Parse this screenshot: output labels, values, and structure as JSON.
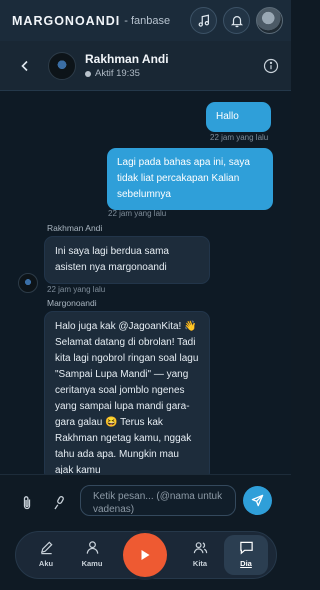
{
  "topbar": {
    "brand": "MARGONOANDI",
    "brand_sub": "- fanbase",
    "icons": [
      "music-icon",
      "bell-icon",
      "user-avatar"
    ]
  },
  "chat_header": {
    "contact_name": "Rakhman Andi",
    "status": "Aktif 19:35",
    "icons": [
      "back-arrow-icon",
      "info-icon"
    ]
  },
  "messages": [
    {
      "direction": "out",
      "text": "Hallo",
      "time": "22 jam yang lalu"
    },
    {
      "direction": "out",
      "text": "Lagi pada bahas apa ini, saya tidak liat percakapan Kalian sebelumnya",
      "time": "22 jam yang lalu"
    },
    {
      "direction": "in",
      "sender": "Rakhman Andi",
      "text": "Ini saya lagi berdua sama asisten nya margonoandi",
      "time": "22 jam yang lalu"
    },
    {
      "direction": "in",
      "sender": "Margonoandi",
      "text": "Halo juga kak @JagoanKita! 👋 Selamat datang di obrolan! Tadi kita lagi ngobrol ringan soal lagu \"Sampai Lupa Mandi\" — yang ceritanya soal jomblo ngenes yang sampai lupa mandi gara-gara galau 😆 Terus kak Rakhman ngetag kamu, nggak tahu ada apa. Mungkin mau ajak kamu"
    }
  ],
  "input": {
    "placeholder": "Ketik pesan... (@nama untuk vadenas)"
  },
  "nav": {
    "items": [
      {
        "label": "Aku",
        "icon": "pen-icon"
      },
      {
        "label": "Kamu",
        "icon": "user-icon"
      },
      {
        "label": "Kita",
        "icon": "users-icon"
      },
      {
        "label": "Dia",
        "icon": "chat-icon",
        "active": true
      }
    ],
    "center_icon": "play-icon"
  },
  "colors": {
    "accent": "#2f9fd9",
    "play": "#ee5a32",
    "background": "#0f1a24"
  }
}
